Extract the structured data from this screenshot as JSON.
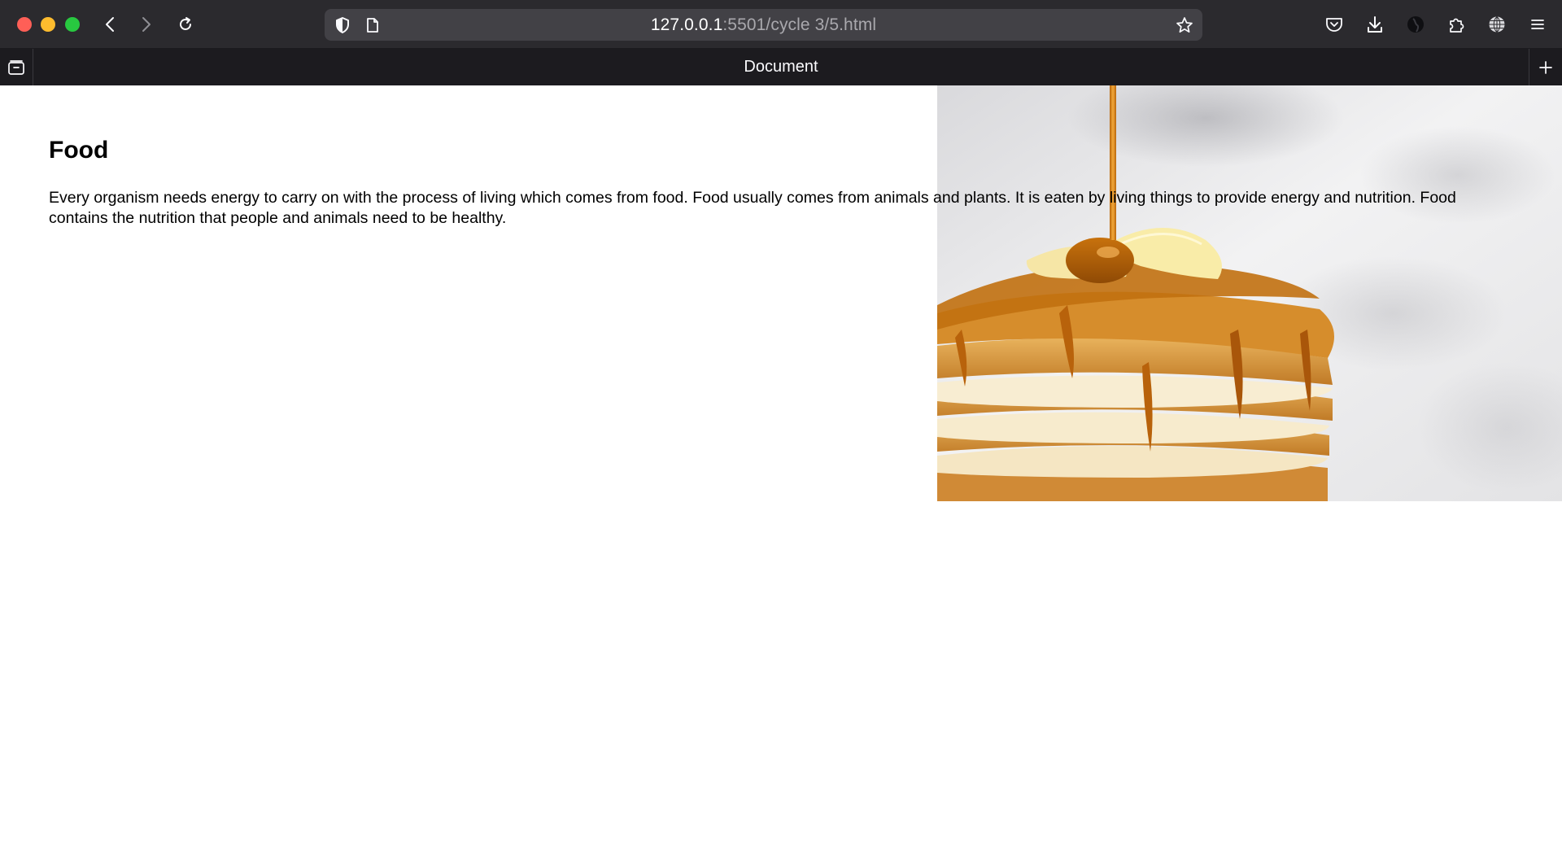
{
  "browser": {
    "url_host": "127.0.0.1",
    "url_path": ":5501/cycle 3/5.html",
    "tab_title": "Document",
    "icons": {
      "back": "chevron-left-icon",
      "forward": "chevron-right-icon",
      "reload": "reload-icon",
      "tracking": "shield-icon",
      "page": "page-icon",
      "bookmark": "star-icon",
      "pocket": "pocket-icon",
      "downloads": "download-icon",
      "account": "account-icon",
      "extensions": "puzzle-icon",
      "language": "globe-icon",
      "menu": "hamburger-menu-icon",
      "tab_tray": "tab-tray-icon",
      "new_tab": "plus-icon"
    }
  },
  "page": {
    "heading": "Food",
    "paragraph": "Every organism needs energy to carry on with the process of living which comes from food. Food usually comes from animals and plants. It is eaten by living things to provide energy and nutrition. Food contains the nutrition that people and animals need to be healthy.",
    "image": "pancakes-with-syrup-image"
  }
}
